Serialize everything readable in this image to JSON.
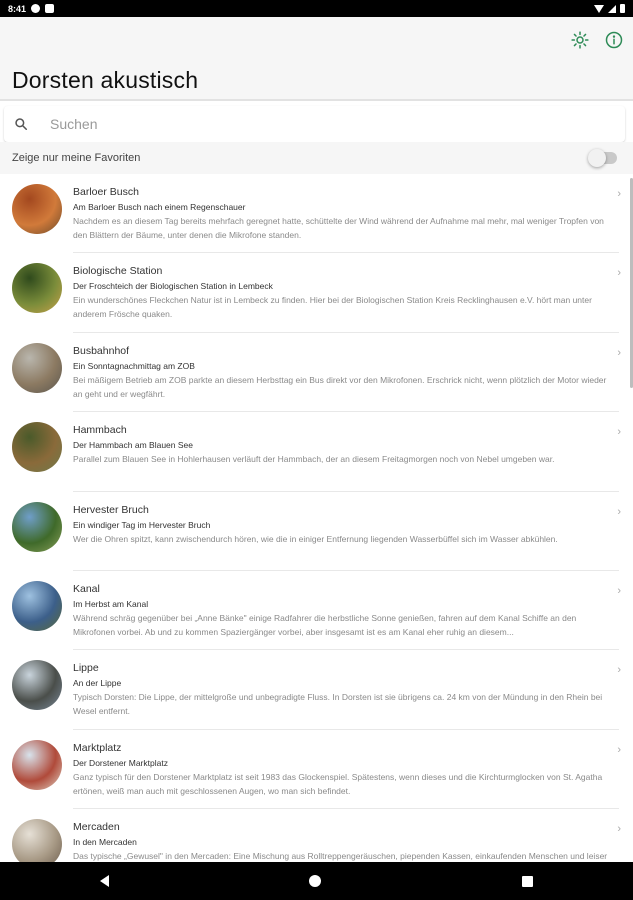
{
  "status_bar": {
    "time": "8:41"
  },
  "app_bar": {
    "title": "Dorsten akustisch",
    "brightness_icon": "brightness-icon",
    "info_icon": "info-icon",
    "accent_color": "#2e8b57"
  },
  "search": {
    "placeholder": "Suchen",
    "value": ""
  },
  "favorites": {
    "label": "Zeige nur meine Favoriten",
    "enabled": false
  },
  "items": [
    {
      "title": "Barloer Busch",
      "subtitle": "Am Barloer Busch nach einem Regenschauer",
      "description": "Nachdem es an diesem Tag bereits mehrfach geregnet hatte, schüttelte der Wind während der Aufnahme mal mehr, mal weniger Tropfen von den Blättern der Bäume, unter denen die Mikrofone standen.",
      "colors": [
        "#a3481f",
        "#d17a3a",
        "#6b4a2a"
      ]
    },
    {
      "title": "Biologische Station",
      "subtitle": "Der Froschteich der Biologischen Station in Lembeck",
      "description": "Ein wunderschönes Fleckchen Natur ist in Lembeck zu finden. Hier bei der Biologischen Station Kreis Recklinghausen e.V. hört man unter anderem Frösche quaken.",
      "colors": [
        "#2f4a1c",
        "#7a8c3a",
        "#c9a24a"
      ]
    },
    {
      "title": "Busbahnhof",
      "subtitle": "Ein Sonntagnachmittag am ZOB",
      "description": "Bei mäßigem Betrieb am ZOB parkte an diesem Herbsttag ein Bus direkt vor den Mikrofonen. Erschrick nicht, wenn plötzlich der Motor wieder an geht und er wegfährt.",
      "colors": [
        "#b9b6ad",
        "#8c7a62",
        "#5a564e"
      ]
    },
    {
      "title": "Hammbach",
      "subtitle": "Der Hammbach am Blauen See",
      "description": "Parallel zum Blauen See in Hohlerhausen verläuft der Hammbach, der an diesem Freitagmorgen noch von Nebel umgeben war.",
      "colors": [
        "#4a5a2a",
        "#8a6a3a",
        "#6e7b4a"
      ]
    },
    {
      "title": "Hervester Bruch",
      "subtitle": "Ein windiger Tag im Hervester Bruch",
      "description": "Wer die Ohren spitzt, kann zwischendurch hören, wie die in einiger Entfernung liegenden Wasserbüffel sich im Wasser abkühlen.",
      "colors": [
        "#6f9ec9",
        "#3f6a2a",
        "#8aa05a"
      ]
    },
    {
      "title": "Kanal",
      "subtitle": "Im Herbst am Kanal",
      "description": "Während schräg gegenüber bei „Anne Bänke\" einige Radfahrer die herbstliche Sonne genießen, fahren auf dem Kanal Schiffe an den Mikrofonen vorbei. Ab und zu kommen Spaziergänger vorbei, aber insgesamt ist es am Kanal eher ruhig an diesem...",
      "colors": [
        "#9ec1e0",
        "#3c5f8a",
        "#5a6a3a"
      ]
    },
    {
      "title": "Lippe",
      "subtitle": "An der Lippe",
      "description": "Typisch Dorsten: Die Lippe, der mittelgroße und unbegradigte Fluss. In Dorsten ist sie übrigens ca. 24 km von der Mündung in den Rhein bei Wesel entfernt.",
      "colors": [
        "#c9d4dc",
        "#4a4e4a",
        "#7a8a9a"
      ]
    },
    {
      "title": "Marktplatz",
      "subtitle": "Der Dorstener Marktplatz",
      "description": "Ganz typisch für den Dorstener Marktplatz ist seit 1983 das Glockenspiel. Spätestens, wenn dieses und die Kirchturmglocken von St. Agatha ertönen, weiß man auch mit geschlossenen Augen, wo man sich befindet.",
      "colors": [
        "#d8e3ec",
        "#b04a3a",
        "#e0d6c6"
      ]
    },
    {
      "title": "Mercaden",
      "subtitle": "In den Mercaden",
      "description": "Das typische „Gewusel\" in den Mercaden: Eine Mischung aus Rolltreppengeräuschen, piependen Kassen, einkaufenden Menschen und leiser Hintergrundmusik.",
      "colors": [
        "#e6e0d6",
        "#a89a86",
        "#6a5a4a"
      ]
    }
  ]
}
